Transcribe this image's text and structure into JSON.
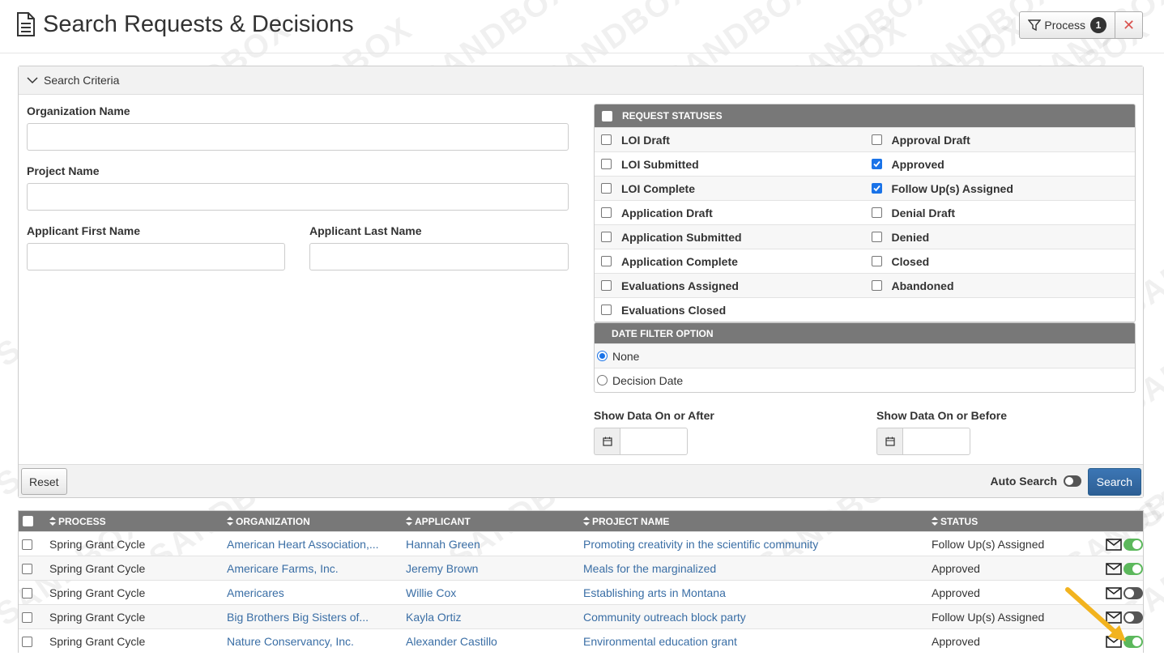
{
  "header": {
    "title": "Search Requests & Decisions",
    "process_label": "Process",
    "process_count": "1",
    "close_glyph": "✕"
  },
  "watermark": "SANDBOX",
  "criteria": {
    "title": "Search Criteria",
    "organization_label": "Organization Name",
    "project_label": "Project Name",
    "first_name_label": "Applicant First Name",
    "last_name_label": "Applicant Last Name",
    "organization_value": "",
    "project_value": "",
    "first_name_value": "",
    "last_name_value": "",
    "statuses_title": "REQUEST STATUSES",
    "statuses": [
      [
        {
          "label": "LOI Draft",
          "checked": false
        },
        {
          "label": "Approval Draft",
          "checked": false
        }
      ],
      [
        {
          "label": "LOI Submitted",
          "checked": false
        },
        {
          "label": "Approved",
          "checked": true
        }
      ],
      [
        {
          "label": "LOI Complete",
          "checked": false
        },
        {
          "label": "Follow Up(s) Assigned",
          "checked": true
        }
      ],
      [
        {
          "label": "Application Draft",
          "checked": false
        },
        {
          "label": "Denial Draft",
          "checked": false
        }
      ],
      [
        {
          "label": "Application Submitted",
          "checked": false
        },
        {
          "label": "Denied",
          "checked": false
        }
      ],
      [
        {
          "label": "Application Complete",
          "checked": false
        },
        {
          "label": "Closed",
          "checked": false
        }
      ],
      [
        {
          "label": "Evaluations Assigned",
          "checked": false
        },
        {
          "label": "Abandoned",
          "checked": false
        }
      ],
      [
        {
          "label": "Evaluations Closed",
          "checked": false
        },
        null
      ]
    ],
    "date_filter_title": "DATE FILTER OPTION",
    "date_options": [
      {
        "label": "None",
        "selected": true
      },
      {
        "label": "Decision Date",
        "selected": false
      }
    ],
    "date_after_label": "Show Data On or After",
    "date_before_label": "Show Data On or Before",
    "reset_label": "Reset",
    "auto_search_label": "Auto Search",
    "auto_search_on": false,
    "search_label": "Search"
  },
  "results": {
    "columns": [
      "PROCESS",
      "ORGANIZATION",
      "APPLICANT",
      "PROJECT NAME",
      "STATUS"
    ],
    "rows": [
      {
        "process": "Spring Grant Cycle",
        "organization": "American Heart Association,...",
        "applicant": "Hannah Green",
        "project": "Promoting creativity in the scientific community",
        "status": "Follow Up(s) Assigned",
        "toggle_on": true
      },
      {
        "process": "Spring Grant Cycle",
        "organization": "Americare Farms, Inc.",
        "applicant": "Jeremy Brown",
        "project": "Meals for the marginalized",
        "status": "Approved",
        "toggle_on": true
      },
      {
        "process": "Spring Grant Cycle",
        "organization": "Americares",
        "applicant": "Willie Cox",
        "project": "Establishing arts in Montana",
        "status": "Approved",
        "toggle_on": false
      },
      {
        "process": "Spring Grant Cycle",
        "organization": "Big Brothers Big Sisters of...",
        "applicant": "Kayla Ortiz",
        "project": "Community outreach block party",
        "status": "Follow Up(s) Assigned",
        "toggle_on": false
      },
      {
        "process": "Spring Grant Cycle",
        "organization": "Nature Conservancy, Inc.",
        "applicant": "Alexander Castillo",
        "project": "Environmental education grant",
        "status": "Approved",
        "toggle_on": true
      }
    ]
  },
  "colors": {
    "link": "#3a6ea5",
    "header_bar": "#787878",
    "primary_button": "#2d5f95",
    "toggle_on": "#5cb85c",
    "annotation_arrow": "#f2b31f"
  }
}
